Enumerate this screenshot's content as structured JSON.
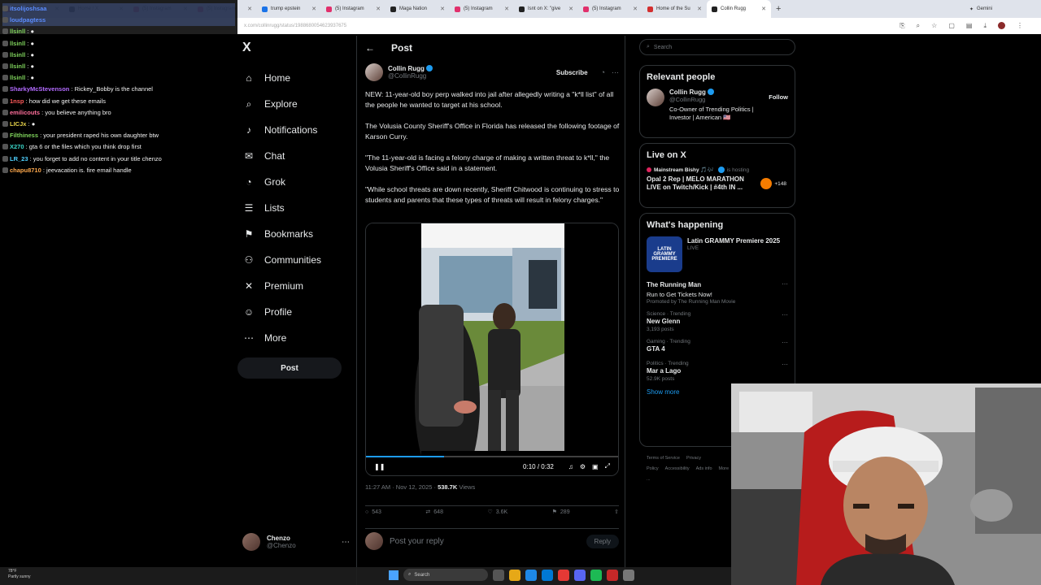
{
  "browser": {
    "tabs": [
      {
        "label": "(9) The Sponge",
        "color": "#d32f2f"
      },
      {
        "label": "Home / X",
        "color": "#222222"
      },
      {
        "label": "(5) Instagram",
        "color": "#e1306c"
      },
      {
        "label": "(5) Instagram",
        "color": "#e1306c"
      },
      {
        "label": "trump epstein",
        "color": "#1a73e8"
      },
      {
        "label": "(5) Instagram",
        "color": "#e1306c"
      },
      {
        "label": "Maga Nation",
        "color": "#222222"
      },
      {
        "label": "(5) Instagram",
        "color": "#e1306c"
      },
      {
        "label": "Isnt on X: \"give",
        "color": "#222222"
      },
      {
        "label": "(5) Instagram",
        "color": "#e1306c"
      },
      {
        "label": "Home of the Su",
        "color": "#d32f2f"
      },
      {
        "label": "Collin Rugg",
        "color": "#222222",
        "active": true
      }
    ],
    "gemini_label": "Gemini",
    "url": "x.com/collinrugg/status/1988680054623937675"
  },
  "chat": [
    {
      "user": "itsolijoshsaa",
      "color": "#5b8cff",
      "msg": ""
    },
    {
      "user": "loudpagtess",
      "color": "#5b8cff",
      "msg": ""
    },
    {
      "user": "llsinll",
      "color": "#7fd35c",
      "msg": "●"
    },
    {
      "user": "llsinll",
      "color": "#7fd35c",
      "msg": "●"
    },
    {
      "user": "llsinll",
      "color": "#7fd35c",
      "msg": "●"
    },
    {
      "user": "llsinll",
      "color": "#7fd35c",
      "msg": "●"
    },
    {
      "user": "llsinll",
      "color": "#7fd35c",
      "msg": "●"
    },
    {
      "user": "SharkyMcStevenson",
      "color": "#b36bff",
      "msg": "Rickey_Bobby is the channel"
    },
    {
      "user": "1nsp",
      "color": "#ff5a5a",
      "msg": "how did we get these emails"
    },
    {
      "user": "emilicouts",
      "color": "#ff6f9b",
      "msg": "you believe anything bro"
    },
    {
      "user": "LICJx",
      "color": "#e6d24a",
      "msg": "●"
    },
    {
      "user": "Filthiness",
      "color": "#7fd35c",
      "msg": "your president raped his own daughter btw"
    },
    {
      "user": "X270",
      "color": "#3ad7c9",
      "msg": "gta 6 or the files which you think drop first"
    },
    {
      "user": "LR_23",
      "color": "#4fd1ff",
      "msg": "you forget to add no content in your title chenzo"
    },
    {
      "user": "chapu8710",
      "color": "#ffa94d",
      "msg": "jeevacation is. fire email handle"
    }
  ],
  "nav": {
    "logo": "X",
    "items": [
      {
        "label": "Home",
        "icon": "⌂",
        "name": "home"
      },
      {
        "label": "Explore",
        "icon": "⌕",
        "name": "explore"
      },
      {
        "label": "Notifications",
        "icon": "♪",
        "name": "notifications"
      },
      {
        "label": "Chat",
        "icon": "✉",
        "name": "chat"
      },
      {
        "label": "Grok",
        "icon": "◔",
        "name": "grok"
      },
      {
        "label": "Lists",
        "icon": "☰",
        "name": "lists"
      },
      {
        "label": "Bookmarks",
        "icon": "⚑",
        "name": "bookmarks"
      },
      {
        "label": "Communities",
        "icon": "⚇",
        "name": "communities"
      },
      {
        "label": "Premium",
        "icon": "✕",
        "name": "premium"
      },
      {
        "label": "Profile",
        "icon": "☺",
        "name": "profile"
      },
      {
        "label": "More",
        "icon": "⋯",
        "name": "more"
      }
    ],
    "post_button": "Post",
    "account": {
      "name": "Chenzo",
      "handle": "@Chenzo"
    }
  },
  "post": {
    "header": "Post",
    "back_icon": "←",
    "author": {
      "name": "Collin Rugg",
      "handle": "@CollinRugg"
    },
    "subscribe": "Subscribe",
    "paragraphs": [
      "NEW: 11-year-old boy perp walked into jail after allegedly writing a \"k*ll list\" of all the people he wanted to target at his school.",
      "The Volusia County Sheriff's Office in Florida has released the following footage of Karson Curry.",
      "\"The 11-year-old is facing a felony charge of making a written threat to k*ll,\" the Volusia Sheriff's Office said in a statement.",
      "\"While school threats are down recently, Sheriff Chitwood is continuing to stress to students and parents that these types of threats will result in felony charges.\""
    ],
    "video": {
      "time": "0:10 / 0:32",
      "progress": 0.31
    },
    "timestamp": "11:27 AM · Nov 12, 2025 · ",
    "views": "538.7K",
    "views_label": " Views",
    "actions": {
      "replies": "543",
      "reposts": "648",
      "likes": "3.6K",
      "bookmarks": "289"
    },
    "reply_placeholder": "Post your reply",
    "reply_button": "Reply"
  },
  "right": {
    "search_placeholder": "Search",
    "relevant": {
      "title": "Relevant people",
      "name": "Collin Rugg",
      "handle": "@CollinRugg",
      "bio": "Co-Owner of Trending Politics | Investor | American 🇺🇸",
      "follow": "Follow"
    },
    "live": {
      "title": "Live on X",
      "host": "Mainstream Bishy 🎵🎶",
      "status": "is hosting",
      "stream_title": "Opal 2 Rep | MELO MARATHON LIVE on Twitch/Kick | #4th IN ...",
      "count": "+148"
    },
    "happening": {
      "title": "What's happening",
      "feature": {
        "title": "Latin GRAMMY Premiere 2025",
        "status": "LIVE",
        "thumb": "LATIN GRAMMY PREMIERE"
      },
      "trends": [
        {
          "cat": "",
          "name": "The Running Man",
          "sub": "Run to Get Tickets Now!",
          "count": "Promoted by The Running Man Movie"
        },
        {
          "cat": "Science · Trending",
          "name": "New Glenn",
          "sub": "",
          "count": "3,193 posts"
        },
        {
          "cat": "Gaming · Trending",
          "name": "GTA 4",
          "sub": "",
          "count": ""
        },
        {
          "cat": "Politics · Trending",
          "name": "Mar a Lago",
          "sub": "",
          "count": "52.9K posts"
        }
      ],
      "show_more": "Show more"
    },
    "footer": [
      "Terms of Service",
      "Privacy Policy",
      "Accessibility",
      "Ads info",
      "More ..."
    ]
  },
  "taskbar": {
    "weather_temp": "78°F",
    "weather_desc": "Partly sunny",
    "search": "Search"
  }
}
